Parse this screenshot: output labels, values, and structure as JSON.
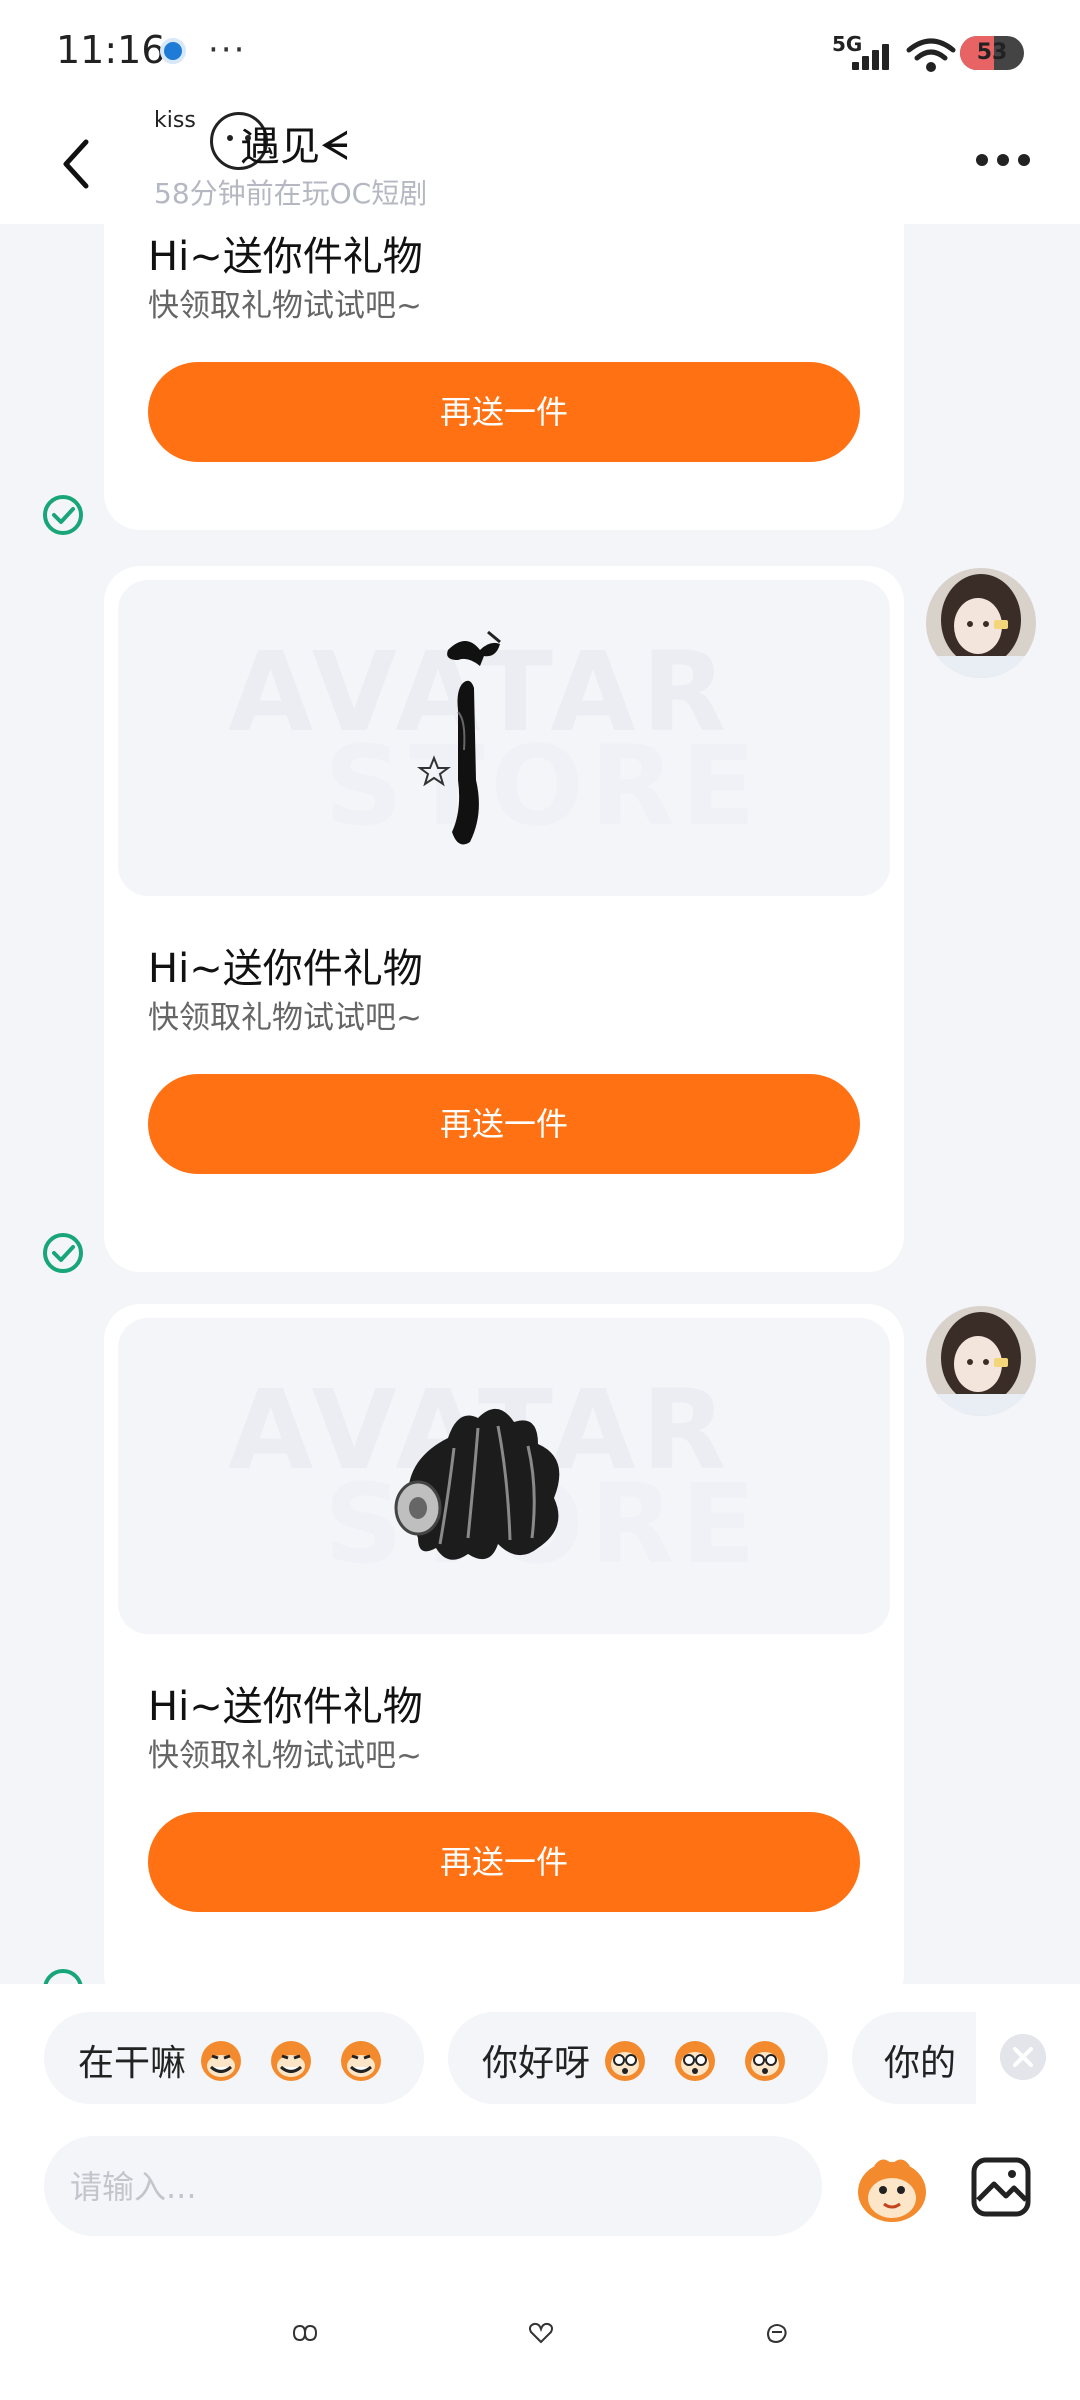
{
  "status_bar": {
    "time": "11:16",
    "dots": "···",
    "network": "5G",
    "battery": "53",
    "battery_level": 0.53
  },
  "header": {
    "kiss_label": "kiss",
    "name": "遇见ᗕ",
    "status": "58分钟前在玩OC短剧"
  },
  "messages": [
    {
      "title": "Hi~送你件礼物",
      "subtitle": "快领取礼物试试吧~",
      "button": "再送一件"
    },
    {
      "title": "Hi~送你件礼物",
      "subtitle": "快领取礼物试试吧~",
      "button": "再送一件",
      "watermark": [
        "AVATAR",
        "STORE"
      ]
    },
    {
      "title": "Hi~送你件礼物",
      "subtitle": "快领取礼物试试吧~",
      "button": "再送一件",
      "watermark": [
        "AVATAR",
        "STORE"
      ]
    }
  ],
  "quick_replies": [
    {
      "text": "在干嘛"
    },
    {
      "text": "你好呀"
    },
    {
      "text": "你的"
    }
  ],
  "input": {
    "placeholder": "请输入..."
  },
  "colors": {
    "accent": "#ff7112",
    "background": "#f4f5f9",
    "check": "#18a577"
  },
  "icons": [
    "back-icon",
    "more-icon",
    "check-icon",
    "monkey-emoji-icon",
    "close-icon",
    "image-icon",
    "home-nav-icon",
    "heart-nav-icon",
    "gesture-nav-icon"
  ]
}
